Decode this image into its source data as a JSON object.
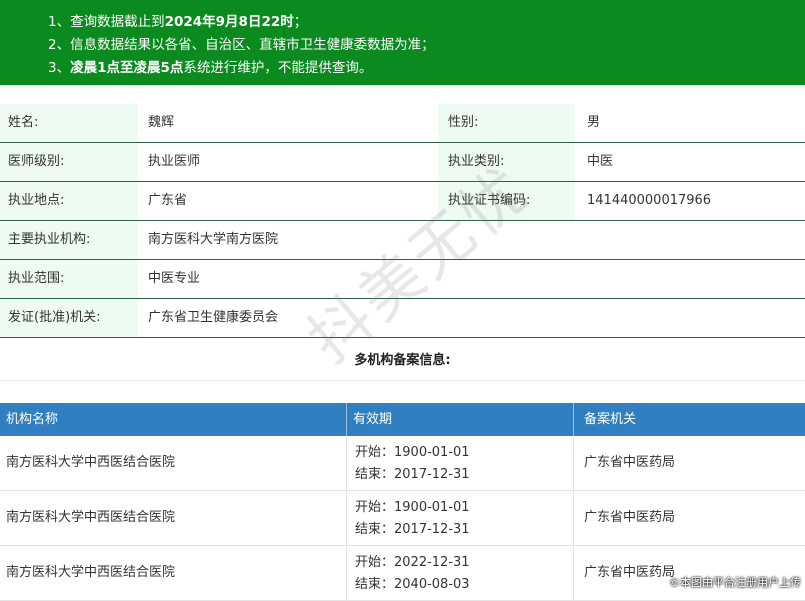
{
  "notice": {
    "line1_prefix": "1、查询数据截止到",
    "line1_bold": "2024年9月8日22时",
    "line1_suffix": "；",
    "line2": "2、信息数据结果以各省、自治区、直辖市卫生健康委数据为准；",
    "line3_prefix": "3、",
    "line3_bold": "凌晨1点至凌晨5点",
    "line3_suffix": "系统进行维护，不能提供查询。"
  },
  "info": {
    "rows": [
      {
        "l1": "姓名:",
        "v1": "魏辉",
        "l2": "性别:",
        "v2": "男"
      },
      {
        "l1": "医师级别:",
        "v1": "执业医师",
        "l2": "执业类别:",
        "v2": "中医"
      },
      {
        "l1": "执业地点:",
        "v1": "广东省",
        "l2": "执业证书编码:",
        "v2": "141440000017966"
      },
      {
        "l1": "主要执业机构:",
        "v1": "南方医科大学南方医院",
        "l2": "",
        "v2": ""
      },
      {
        "l1": "执业范围:",
        "v1": "中医专业",
        "l2": "",
        "v2": ""
      },
      {
        "l1": "发证(批准)机关:",
        "v1": "广东省卫生健康委员会",
        "l2": "",
        "v2": ""
      }
    ]
  },
  "multi": {
    "title": "多机构备案信息:",
    "headers": {
      "org": "机构名称",
      "validity": "有效期",
      "authority": "备案机关"
    },
    "rows": [
      {
        "org": "南方医科大学中西医结合医院",
        "start": "开始：1900-01-01",
        "end": "结束：2017-12-31",
        "authority": "广东省中医药局"
      },
      {
        "org": "南方医科大学中西医结合医院",
        "start": "开始：1900-01-01",
        "end": "结束：2017-12-31",
        "authority": "广东省中医药局"
      },
      {
        "org": "南方医科大学中西医结合医院",
        "start": "开始：2022-12-31",
        "end": "结束：2040-08-03",
        "authority": "广东省中医药局"
      }
    ]
  },
  "watermark": "抖美无忧",
  "credit": "©本图由平台注册用户上传",
  "colors": {
    "notice_bg": "#0b8a1f",
    "table_header_bg": "#2f7fc1",
    "label_bg": "#eefbf3"
  }
}
